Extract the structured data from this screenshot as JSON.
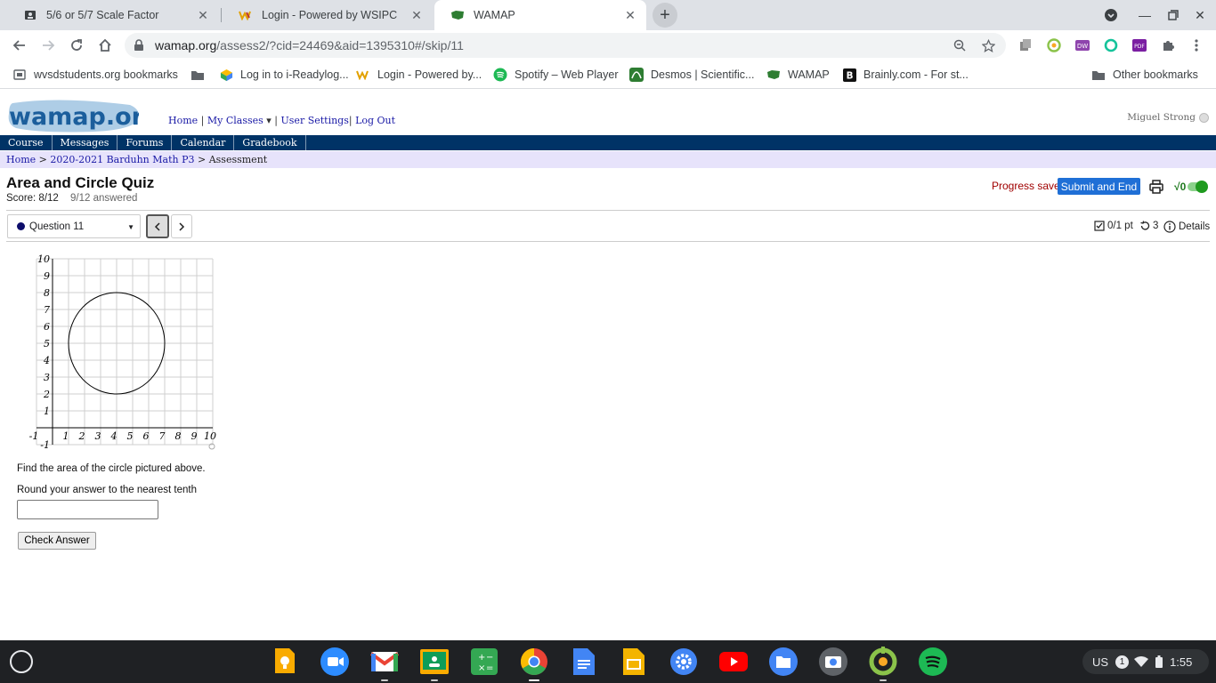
{
  "tabs": [
    {
      "title": "5/6 or 5/7 Scale Factor"
    },
    {
      "title": "Login - Powered by WSIPC"
    },
    {
      "title": "WAMAP"
    }
  ],
  "address": {
    "host": "wamap.org",
    "path": "/assess2/?cid=24469&aid=1395310#/skip/11"
  },
  "bookmarks": [
    "wvsdstudents.org bookmarks",
    "Log in to i-Readylog...",
    "Login - Powered by...",
    "Spotify – Web Player",
    "Desmos | Scientific...",
    "WAMAP",
    "Brainly.com - For st...",
    "Other bookmarks"
  ],
  "site": {
    "logo_text": "wamap.org",
    "topnav": {
      "home": "Home",
      "my_classes": "My Classes",
      "user_settings": "User Settings",
      "log_out": "Log Out"
    },
    "user_name": "Miguel Strong",
    "nav": [
      "Course",
      "Messages",
      "Forums",
      "Calendar",
      "Gradebook"
    ],
    "breadcrumb": {
      "home": "Home",
      "course": "2020-2021 Barduhn Math P3",
      "current": "Assessment"
    }
  },
  "assessment": {
    "title": "Area and Circle Quiz",
    "score": "Score: 8/12",
    "answered": "9/12 answered",
    "progress_saved": "Progress saved",
    "submit_label": "Submit and End",
    "math_toggle_symbol": "√0",
    "question_selector": "Question 11",
    "points": "0/1 pt",
    "retries": "3",
    "details": "Details"
  },
  "question": {
    "prompt": "Find the area of the circle pictured above.",
    "instruction": "Round your answer to the nearest tenth",
    "answer_value": "",
    "check_label": "Check Answer"
  },
  "graph": {
    "x_ticks": [
      "-1",
      "1",
      "2",
      "3",
      "4",
      "5",
      "6",
      "7",
      "8",
      "9",
      "10"
    ],
    "y_ticks": [
      "10",
      "9",
      "8",
      "7",
      "6",
      "5",
      "4",
      "3",
      "2",
      "1",
      "-1"
    ],
    "xlim": [
      -1,
      10
    ],
    "ylim": [
      -1,
      10
    ],
    "circle": {
      "center_x": 4,
      "center_y": 5,
      "radius": 3
    }
  },
  "tray": {
    "locale": "US",
    "notifications": "1",
    "time": "1:55"
  },
  "colors": {
    "nav_bg": "#003366",
    "breadcrumb_bg": "#e7e3fb",
    "submit_bg": "#1f6fd6",
    "progress_saved": "#a00000"
  }
}
